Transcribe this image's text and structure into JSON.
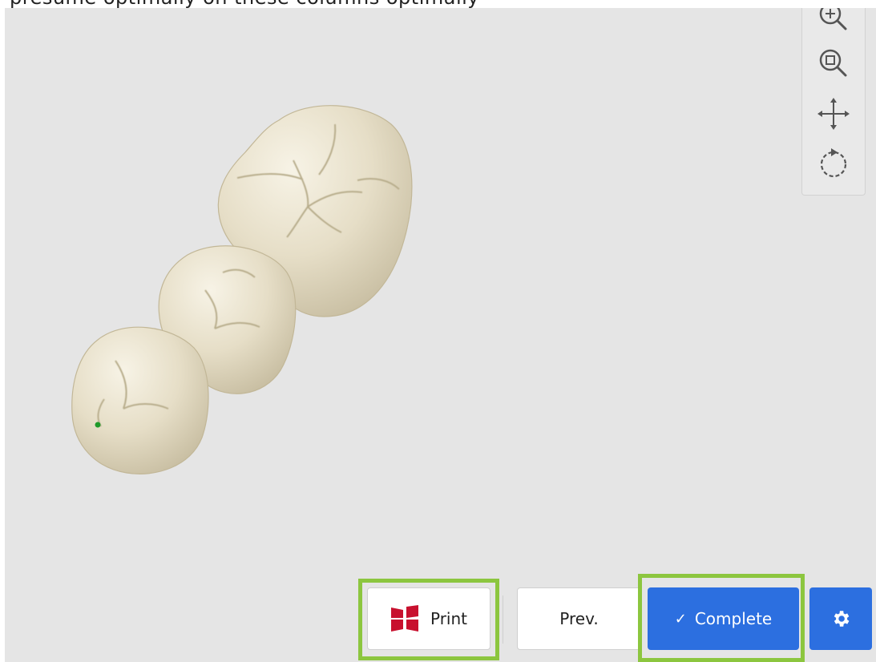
{
  "top_text": "presume optimally on these columns optimally",
  "view_tools": {
    "zoom_fit": "zoom-fit-icon",
    "zoom_region": "zoom-region-icon",
    "pan": "pan-icon",
    "rotate": "rotate-icon"
  },
  "actions": {
    "print_label": "Print",
    "prev_label": "Prev.",
    "complete_label": "Complete",
    "complete_icon": "checkmark-icon",
    "settings_icon": "gear-icon"
  },
  "colors": {
    "viewport_bg": "#e5e5e5",
    "accent_blue": "#2c6fe0",
    "highlight_green": "#8cc63f",
    "print_logo_red": "#c8102e",
    "tooth_color": "#e8e1cb",
    "marker_green": "#1f9a2a"
  }
}
